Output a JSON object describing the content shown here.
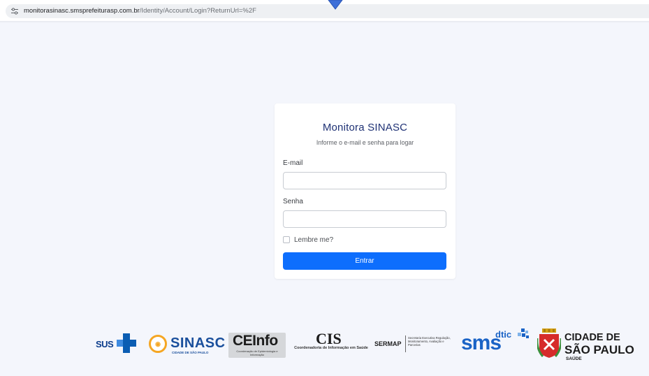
{
  "browser": {
    "url_domain": "monitorasinasc.smsprefeiturasp.com.br",
    "url_path": "/Identity/Account/Login?ReturnUrl=%2F",
    "site_info_icon": "tune-icon"
  },
  "login": {
    "title": "Monitora SINASC",
    "subtitle": "Informe o e-mail e senha para logar",
    "email_label": "E-mail",
    "email_value": "",
    "password_label": "Senha",
    "password_value": "",
    "remember_label": "Lembre me?",
    "remember_checked": false,
    "submit_label": "Entrar"
  },
  "logos": {
    "sus": "SUS",
    "sinasc": "SINASC",
    "sinasc_sub": "CIDADE DE SÃO PAULO",
    "ceinfo": "CEInfo",
    "ceinfo_sub": "Coordenação de Epidemiologia e Informação",
    "cis": "CIS",
    "cis_sub": "Coordenadoria de Informação em Saúde",
    "sermap": "SERMAP",
    "sermap_sub": "Secretaria Executiva Regulação, Monitoramento, Avaliação e Parcerias",
    "sms": "sms",
    "dtic": "dtic",
    "cidade_line1": "CIDADE DE",
    "cidade_line2": "SÃO PAULO",
    "cidade_line3": "SAÚDE"
  },
  "colors": {
    "page_bg": "#f4f6fc",
    "title": "#1f3275",
    "primary": "#0d6efd",
    "pointer": "#3d6fd8"
  }
}
